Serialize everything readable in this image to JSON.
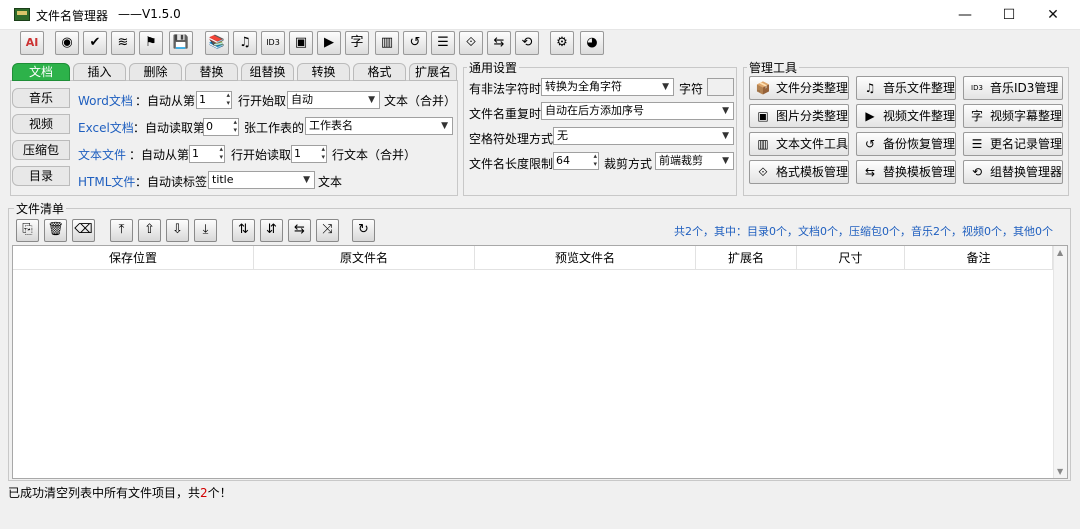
{
  "window": {
    "title": "文件名管理器",
    "version": "——V1.5.0",
    "minimize": "—",
    "maximize": "☐",
    "close": "✕"
  },
  "toolbar": {
    "icons": [
      "ai-icon",
      "eye-icon",
      "check-icon",
      "wave-icon",
      "bookmark-icon",
      "save-disk-icon",
      "books-icon",
      "music-icon",
      "id3-icon",
      "image-icon",
      "video-icon",
      "subtitle-icon",
      "library-icon",
      "backup-icon",
      "log-icon",
      "format-icon",
      "replace-icon",
      "group-icon",
      "gear-icon",
      "palette-icon"
    ],
    "ai_label": "AI",
    "glyphs": [
      "AI",
      "◉",
      "✔",
      "≋",
      "⚑",
      "💾",
      "📚",
      "♫",
      "ID3",
      "▣",
      "▶",
      "字",
      "▥",
      "↺",
      "☰",
      "⟐",
      "⇆",
      "⟲",
      "⚙",
      "◕"
    ]
  },
  "tabs": {
    "top": [
      "文档",
      "插入",
      "删除",
      "替换",
      "组替换",
      "转换",
      "格式",
      "扩展名"
    ],
    "active": "文档",
    "side": [
      "音乐",
      "视频",
      "压缩包",
      "目录"
    ]
  },
  "doc_settings": {
    "word": {
      "label": "Word文档",
      "t1": "：自动从第",
      "n": "1",
      "t2": "行开始取",
      "select": "自动",
      "t3": "文本（合并）"
    },
    "excel": {
      "label": "Excel文档",
      "t1": "：自动读取第",
      "n": "0",
      "t2": "张工作表的",
      "select": "工作表名"
    },
    "text": {
      "label": "文本文件",
      "t1": "：自动从第",
      "n": "1",
      "t2": "行开始读取",
      "n2": "1",
      "t3": "行文本（合并）"
    },
    "html": {
      "label": "HTML文件",
      "t1": "：自动读标签",
      "select": "title",
      "t2": "文本"
    }
  },
  "general": {
    "title": "通用设置",
    "illegal_label": "有非法字符时",
    "illegal_value": "转换为全角字符",
    "char_label": "字符",
    "dup_label": "文件名重复时",
    "dup_value": "自动在后方添加序号",
    "space_label": "空格符处理方式",
    "space_value": "无",
    "len_label": "文件名长度限制",
    "len_value": "64",
    "cut_label": "裁剪方式",
    "cut_value": "前端裁剪"
  },
  "manage": {
    "title": "管理工具",
    "buttons": [
      {
        "label": "文件分类整理",
        "icon": "📦"
      },
      {
        "label": "音乐文件整理",
        "icon": "♫"
      },
      {
        "label": "音乐ID3管理",
        "icon": "ID3"
      },
      {
        "label": "图片分类整理",
        "icon": "▣"
      },
      {
        "label": "视频文件整理",
        "icon": "▶"
      },
      {
        "label": "视频字幕整理",
        "icon": "字"
      },
      {
        "label": "文本文件工具",
        "icon": "▥"
      },
      {
        "label": "备份恢复管理",
        "icon": "↺"
      },
      {
        "label": "更名记录管理",
        "icon": "☰"
      },
      {
        "label": "格式模板管理",
        "icon": "⟐"
      },
      {
        "label": "替换模板管理",
        "icon": "⇆"
      },
      {
        "label": "组替换管理器",
        "icon": "⟲"
      }
    ]
  },
  "list": {
    "title": "文件清单",
    "summary": "共2个，其中：目录0个，文档0个，压缩包0个，音乐2个，视频0个，其他0个",
    "columns": [
      "保存位置",
      "原文件名",
      "预览文件名",
      "扩展名",
      "尺寸",
      "备注"
    ],
    "buttons": [
      "add-files-icon",
      "trash-icon",
      "clear-icon",
      "move-top-icon",
      "move-up-icon",
      "move-down-icon",
      "move-bottom-icon",
      "sort-asc-icon",
      "sort-desc-icon",
      "reverse-icon",
      "shuffle-icon",
      "refresh-icon"
    ],
    "glyphs": [
      "⎘",
      "🗑",
      "⌫",
      "⤒",
      "⇧",
      "⇩",
      "⤓",
      "⇅",
      "⇵",
      "⇆",
      "⤨",
      "↻"
    ]
  },
  "status": {
    "pre": "已成功清空列表中所有文件项目，共",
    "count": "2",
    "post": "个！"
  },
  "colors": {
    "tab_active": "#2db24a",
    "link_blue": "#1f5fbf",
    "status_red": "#d20000"
  }
}
